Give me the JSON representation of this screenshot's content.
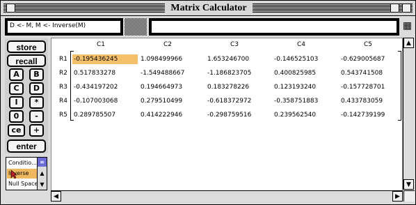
{
  "window": {
    "title": "Matrix Calculator"
  },
  "command": {
    "expression": "D <- M, M <- Inverse(M)",
    "input_value": ""
  },
  "buttons": {
    "store": "store",
    "recall": "recall",
    "A": "A",
    "B": "B",
    "C": "C",
    "D": "D",
    "I": "I",
    "mul": "*",
    "zero": "0",
    "minus": "-",
    "ce": "ce",
    "plus": "+",
    "enter": "enter"
  },
  "ops_list": {
    "items": [
      "Conditio…",
      "Inverse",
      "Null Space"
    ],
    "selected": "Inverse"
  },
  "matrix": {
    "columns": [
      "C1",
      "C2",
      "C3",
      "C4",
      "C5"
    ],
    "rows": [
      {
        "label": "R1",
        "values": [
          "-0.195436245",
          "1.098499966",
          "1.653246700",
          "-0.146525103",
          "-0.629005687"
        ]
      },
      {
        "label": "R2",
        "values": [
          "0.517833278",
          "-1.549488667",
          "-1.186823705",
          "0.400825985",
          "0.543741508"
        ]
      },
      {
        "label": "R3",
        "values": [
          "-0.434197202",
          "0.194664973",
          "0.183278226",
          "0.123193240",
          "-0.157728701"
        ]
      },
      {
        "label": "R4",
        "values": [
          "-0.107003068",
          "0.279510499",
          "-0.618372972",
          "-0.358751883",
          "0.433783059"
        ]
      },
      {
        "label": "R5",
        "values": [
          "0.289785507",
          "0.414222946",
          "-0.298759516",
          "0.239562540",
          "-0.142739199"
        ]
      }
    ],
    "selected_cell": "R1-C1"
  }
}
